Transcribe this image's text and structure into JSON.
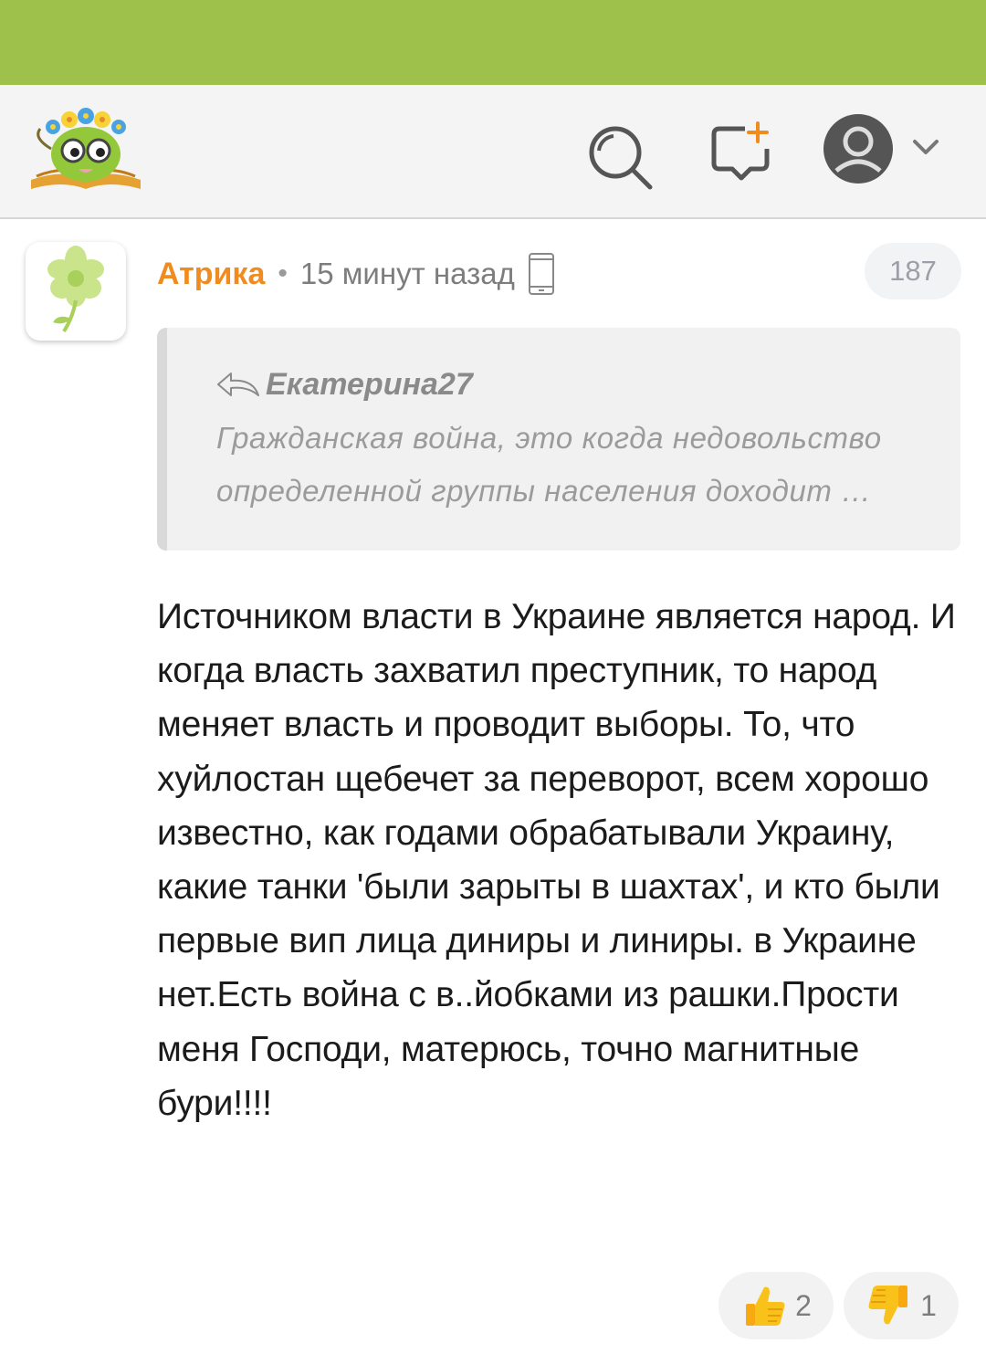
{
  "comment": {
    "author": "Атрика",
    "separator": "•",
    "time": "15 минут назад",
    "count": "187",
    "quote": {
      "author": "Екатерина27",
      "text": "Гражданская война, это когда недовольство определенной группы населения доходит …"
    },
    "text": "Источником власти в Украине является народ. И когда власть захватил преступник, то народ меняет власть и проводит выборы. То, что хуйлостан щебечет за переворот, всем хорошо известно, как годами обрабатывали Украину, какие танки 'были зарыты в шахтах', и кто были первые вип лица диниры и линиры. в Украине нет.Есть война с в..йобками из рашки.Прости меня Господи, матерюсь, точно магнитные бури!!!!",
    "likes": "2",
    "dislikes": "1"
  },
  "colors": {
    "brand_green": "#9dc14a",
    "author_orange": "#f08c1f"
  },
  "icons": [
    "search-icon",
    "add-post-icon",
    "user-avatar-icon",
    "chevron-down-icon",
    "mobile-device-icon",
    "reply-icon",
    "thumbs-up-icon",
    "thumbs-down-icon"
  ]
}
